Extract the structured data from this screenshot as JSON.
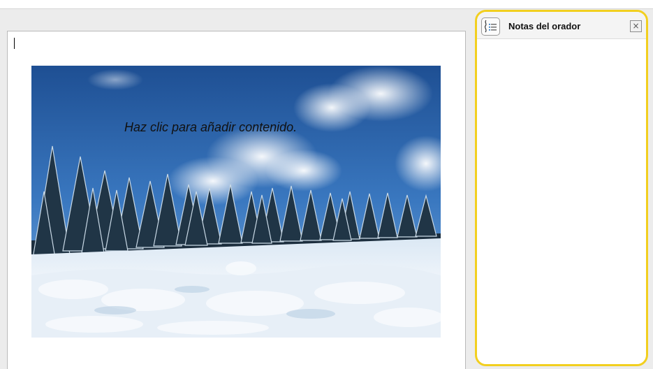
{
  "slide": {
    "placeholder_text": "Haz clic para añadir contenido.",
    "image": "snowy-forest-landscape"
  },
  "notes_panel": {
    "title": "Notas del orador",
    "icon": "speaker-notes-icon",
    "close_icon": "close-icon",
    "close_glyph": "×",
    "text": "",
    "highlight_color": "#f2cf1f"
  }
}
